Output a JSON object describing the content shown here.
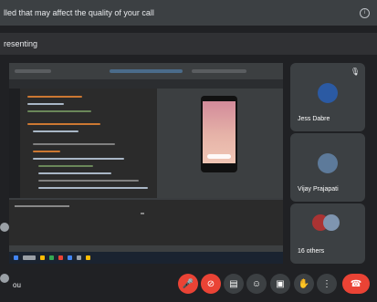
{
  "banner": {
    "text": "lled that may affect the quality of your call"
  },
  "presenting": {
    "text": "resenting"
  },
  "participants": [
    {
      "name": "Jess Dabre"
    },
    {
      "name": "Vijay Prajapati"
    },
    {
      "name": "16 others"
    }
  ],
  "self": {
    "label": "ou"
  },
  "colors": {
    "background": "#202124",
    "tile": "#3c4043",
    "danger": "#ea4335",
    "control": "#3c4043"
  },
  "icons": {
    "mic": "mic-off-icon",
    "cam": "camera-off-icon",
    "captions": "captions-icon",
    "emoji": "emoji-icon",
    "present": "present-icon",
    "hand": "raise-hand-icon",
    "more": "more-icon",
    "hangup": "hangup-icon"
  }
}
